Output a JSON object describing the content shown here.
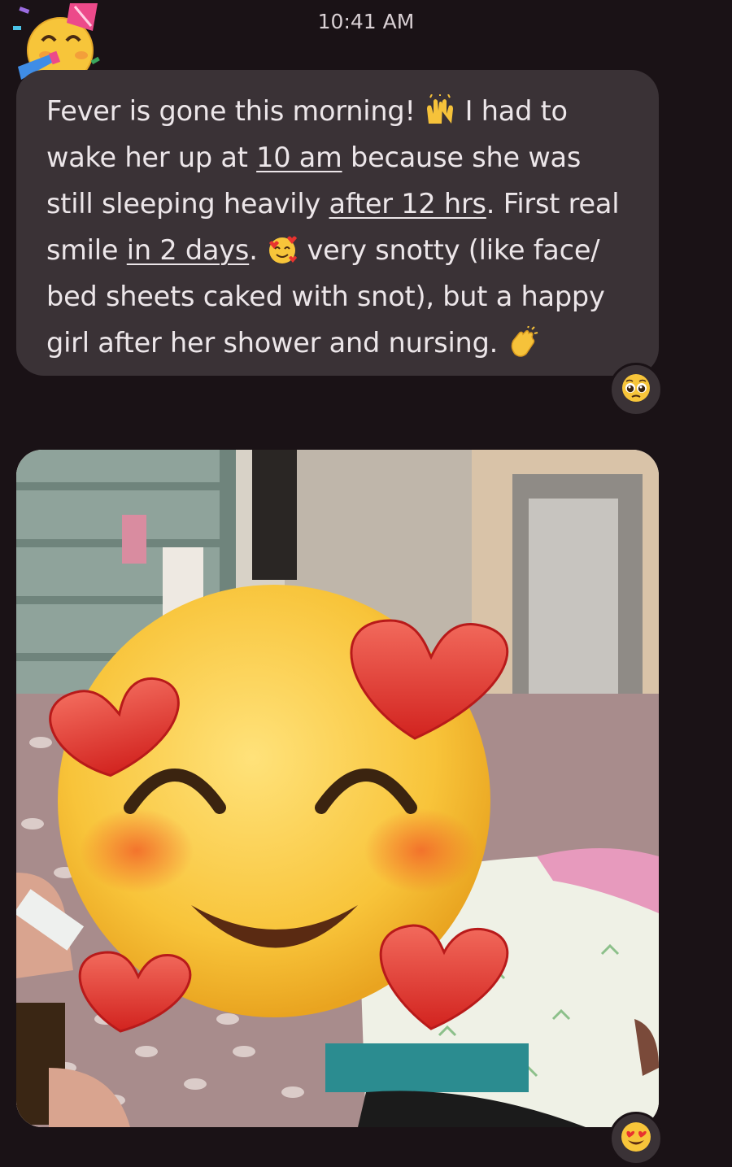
{
  "status": {
    "time": "10:41 AM"
  },
  "sender": {
    "avatar_icon": "partying-face-icon"
  },
  "message": {
    "seg1": "Fever is gone this morning! ",
    "emoji1": "raising-hands-icon",
    "seg2": " I had to wake her up at ",
    "link1": "10 am",
    "seg3": " because she was still sleeping heavily ",
    "link2": "after 12 hrs",
    "seg4": ". First real smile ",
    "link3": "in 2 days",
    "seg5": ". ",
    "emoji2": "smiling-face-with-hearts-icon",
    "seg6": " very snotty (like face/ bed sheets caked with snot), but a happy girl after her shower and nursing. ",
    "emoji3": "clapping-hands-icon",
    "reaction": "pleading-face-icon"
  },
  "photo_message": {
    "overlay_sticker": "smiling-face-with-hearts-icon",
    "reaction": "heart-eyes-icon"
  },
  "colors": {
    "background": "#1a1216",
    "bubble": "#3a3236",
    "text": "#ece6e9"
  }
}
